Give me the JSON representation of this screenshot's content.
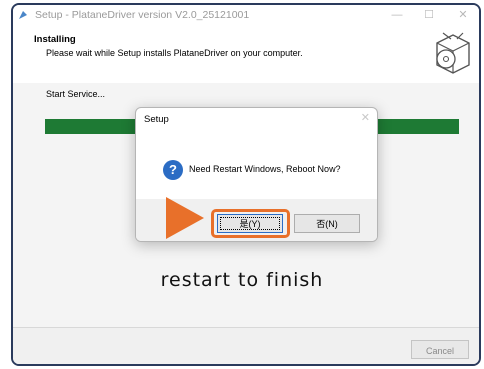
{
  "window": {
    "title": "Setup - PlataneDriver version V2.0_25121001",
    "min_glyph": "—",
    "max_glyph": "☐",
    "close_glyph": "✕"
  },
  "header": {
    "heading": "Installing",
    "subtitle": "Please wait while Setup installs PlataneDriver on your computer."
  },
  "content": {
    "status_text": "Start Service...",
    "progress_percent": 100,
    "progress_color": "#1e7a34"
  },
  "footer": {
    "cancel_label": "Cancel"
  },
  "dialog": {
    "title": "Setup",
    "close_glyph": "✕",
    "icon": "question-icon",
    "icon_glyph": "?",
    "message": "Need Restart Windows, Reboot Now?",
    "yes_label": "是(Y)",
    "no_label": "否(N)"
  },
  "annotation": {
    "caption": "restart to finish",
    "accent_color": "#e8702a"
  }
}
